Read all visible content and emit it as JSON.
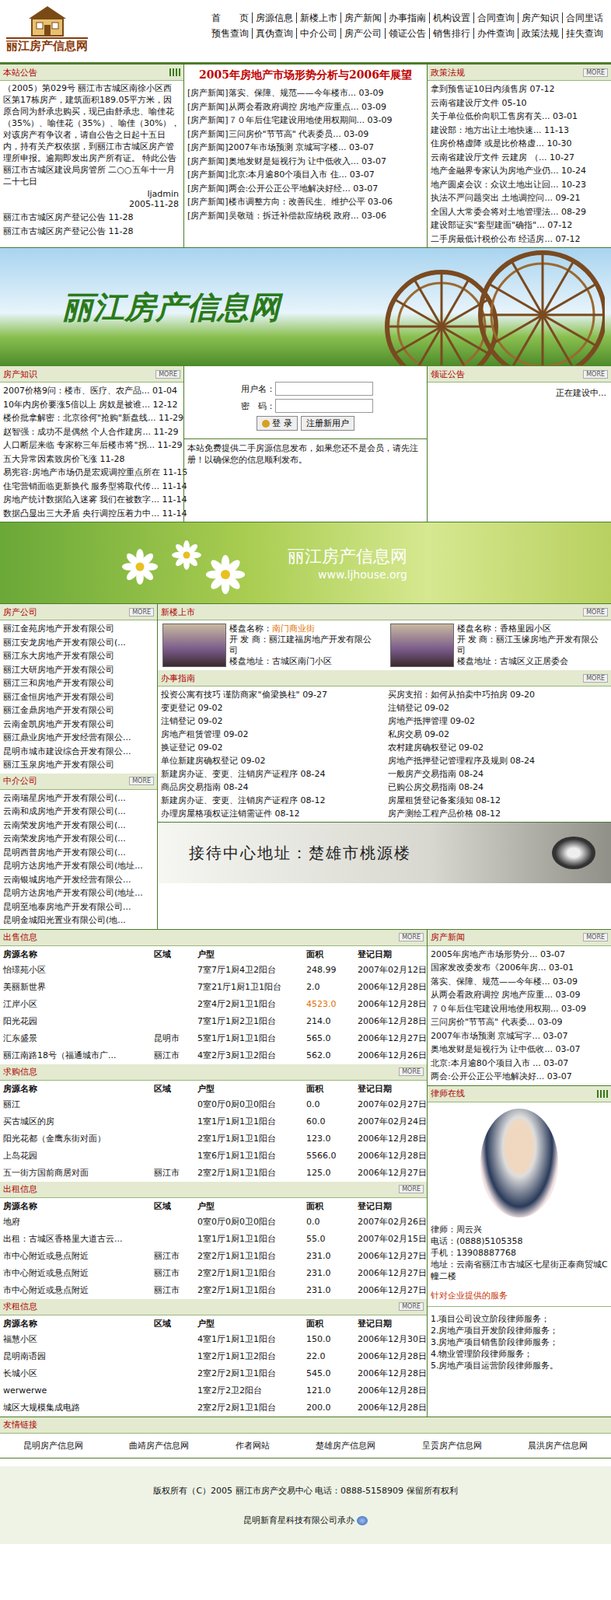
{
  "logo": {
    "title": "丽江房产信息网"
  },
  "nav": {
    "row1": [
      "首　　页",
      "房源信息",
      "新楼上市",
      "房产新闻",
      "办事指南",
      "机构设置",
      "合同查询",
      "房产知识",
      "合同里话"
    ],
    "row2": [
      "预售查询",
      "真伪查询",
      "中介公司",
      "房产公司",
      "领证公告",
      "销售排行",
      "办件查询",
      "政策法规",
      "挂失查询"
    ]
  },
  "notice": {
    "title": "本站公告",
    "body": "（2005）第029号 丽江市古城区南徐小区西区第17栋房产，建筑面积189.05平方米，因原合同为舒承忠购买，现已由舒承忠、喻佳花（35%）、喻佳花（35%）、喻佳（30%），对该房产有争议者，请自公告之日起十五日内，持有关产权依据，到丽江市古城区房产管理所申报。逾期即发出房产所有证。 特此公告 丽江市古城区建设局房管所 二○○五年十一月二十七日",
    "author": "ljadmin",
    "date": "2005-11-28",
    "items": [
      {
        "title": "丽江市古城区房产登记公告",
        "date": "11-28"
      },
      {
        "title": "丽江市古城区房产登记公告",
        "date": "11-28"
      }
    ]
  },
  "headline": {
    "title": "2005年房地产市场形势分析与2006年展望",
    "items": [
      {
        "tag": "[房产新闻]",
        "title": "落实、保障、规范——今年楼市...",
        "date": "03-09"
      },
      {
        "tag": "[房产新闻]",
        "title": "从两会看政府调控 房地产应重点...",
        "date": "03-09"
      },
      {
        "tag": "[房产新闻]",
        "title": "７０年后住宅建设用地使用权期间...",
        "date": "03-09"
      },
      {
        "tag": "[房产新闻]",
        "title": "三问房价\"节节高\" 代表委员...",
        "date": "03-09"
      },
      {
        "tag": "[房产新闻]",
        "title": "2007年市场预测 京城写字楼...",
        "date": "03-07"
      },
      {
        "tag": "[房产新闻]",
        "title": "奥地发财是短视行为 让中低收入...",
        "date": "03-07"
      },
      {
        "tag": "[房产新闻]",
        "title": "北京:本月逾80个项目入市 住...",
        "date": "03-07"
      },
      {
        "tag": "[房产新闻]",
        "title": "两会:公开公正公平地解决好经...",
        "date": "03-07"
      },
      {
        "tag": "[房产新闻]",
        "title": "楼市调整方向：改善民生、维护公平",
        "date": "03-06"
      },
      {
        "tag": "[房产新闻]",
        "title": "吴敬琏：拆迁补偿款应纳税 政府...",
        "date": "03-06"
      }
    ]
  },
  "policy": {
    "title": "政策法规",
    "more": "MORE",
    "items": [
      {
        "title": "拿到预售证10日内须售房",
        "date": "07-12"
      },
      {
        "title": "云南省建设厅文件",
        "date": "05-10"
      },
      {
        "title": "关于单位低价向职工售房有关...",
        "date": "03-01"
      },
      {
        "title": "建设部：地方出让土地快速...",
        "date": "11-13"
      },
      {
        "title": "住房价格虚降 或是比价格虚...",
        "date": "10-30"
      },
      {
        "title": "云南省建设厅文件 云建房 （...",
        "date": "10-27"
      },
      {
        "title": "地产金融界专家认为房地产业仍...",
        "date": "10-24"
      },
      {
        "title": "地产圆桌会议：众议土地出让回...",
        "date": "10-23"
      },
      {
        "title": "执法不严问题突出 土地调控问...",
        "date": "09-21"
      },
      {
        "title": "全国人大常委会将对土地管理法...",
        "date": "08-29"
      },
      {
        "title": "建设部证实\"套型建面\"确指\"...",
        "date": "07-12"
      },
      {
        "title": "二手房最低计税价公布 经适房...",
        "date": "07-12"
      }
    ]
  },
  "banner1": {
    "title": "丽江房产信息网"
  },
  "knowledge": {
    "title": "房产知识",
    "more": "MORE",
    "items": [
      {
        "title": "2007价格9问：楼市、医疗、农产品...",
        "date": "01-04"
      },
      {
        "title": "10年内房价要涨5倍以上 房奴是被谁...",
        "date": "12-12"
      },
      {
        "title": "楼价批拿解密：北京徐何\"抢购\"新盘线...",
        "date": "11-29"
      },
      {
        "title": "赵智强：成功不是偶然 个人合作建房...",
        "date": "11-29"
      },
      {
        "title": "人口断层来临 专家称三年后楼市将\"拐...",
        "date": "11-29"
      },
      {
        "title": "五大异常因素致房价飞涨",
        "date": "11-28"
      },
      {
        "title": "易宪容:房地产市场仍是宏观调控重点所在",
        "date": "11-15"
      },
      {
        "title": "住宅营销面临更新换代 服务型将取代传...",
        "date": "11-14"
      },
      {
        "title": "房地产统计数据陷入迷雾 我们在被数字...",
        "date": "11-14"
      },
      {
        "title": "数据凸显出三大矛盾 央行调控压着力中...",
        "date": "11-14"
      }
    ]
  },
  "login": {
    "user_label": "用户名：",
    "pass_label": "密　码：",
    "login_button": "登 录",
    "register_button": "注册新用户",
    "note": "本站免费提供二手房源信息发布，如果您还不是会员，请先注册！以确保您的信息顺利发布。"
  },
  "license": {
    "title": "领证公告",
    "more": "MORE",
    "body": "正在建设中..."
  },
  "banner2": {
    "title": "丽江房产信息网",
    "url": "www.ljhouse.org"
  },
  "companies": {
    "title": "房产公司",
    "more": "MORE",
    "items": [
      "丽江金苑房地产开发有限公司",
      "丽江安龙房地产开发有限公司(...",
      "丽江东大房地产开发有限公司",
      "丽江大研房地产开发有限公司",
      "丽江三和房地产开发有限公司",
      "丽江金恒房地产开发有限公司",
      "丽江金鼎房地产开发有限公司",
      "云南金凯房地产开发有限公司",
      "丽江鼎业房地产开发经营有限公...",
      "昆明市城市建设综合开发有限公...",
      "丽江玉泉房地产开发有限公司"
    ]
  },
  "agencies": {
    "title": "中介公司",
    "more": "MORE",
    "items": [
      "云南瑞星房地产开发有限公司(...",
      "云南和成房地产开发有限公司(...",
      "云南荣发房地产开发有限公司(...",
      "云南荣发房地产开发有限公司(...",
      "昆明西普房地产开发有限公司(...",
      "昆明方达房地产开发有限公司(地址...",
      "云南银城房地产开发经营有限公...",
      "昆明方达房地产开发有限公司(地址...",
      "昆明至地泰房地产开发有限公司...",
      "昆明金城阳光置业有限公司(地..."
    ]
  },
  "newbuild": {
    "title": "新楼上市",
    "more": "MORE",
    "items": [
      {
        "name_label": "楼盘名称：",
        "name": "南门商业街",
        "dev_label": "开 发 商：",
        "developer": "丽江建福房地产开发有限公司",
        "addr_label": "楼盘地址：",
        "address": "古城区南门小区",
        "highlight": true
      },
      {
        "name_label": "楼盘名称：",
        "name": "香格里园小区",
        "dev_label": "开 发 商：",
        "developer": "丽江玉缘房地产开发有限公司",
        "addr_label": "楼盘地址：",
        "address": "古城区义正居委会",
        "highlight": false
      }
    ]
  },
  "guide": {
    "title": "办事指南",
    "more": "MORE",
    "left": [
      {
        "title": "投资公寓有技巧 谨防商家\"偷梁换柱\"",
        "date": "09-27"
      },
      {
        "title": "变更登记",
        "date": "09-02"
      },
      {
        "title": "注销登记",
        "date": "09-02"
      },
      {
        "title": "房地产租赁管理",
        "date": "09-02"
      },
      {
        "title": "换证登记",
        "date": "09-02"
      },
      {
        "title": "单位新建房确权登记",
        "date": "09-02"
      },
      {
        "title": "新建房办证、变更、注销房产证程序",
        "date": "08-24"
      },
      {
        "title": "商品房交易指南",
        "date": "08-24"
      },
      {
        "title": "新建房办证、变更、注销房产证程序",
        "date": "08-12"
      },
      {
        "title": "办理房屋格项权证注销需证件",
        "date": "08-12"
      }
    ],
    "right": [
      {
        "title": "买房支招：如何从拍卖中巧拍房",
        "date": "09-20"
      },
      {
        "title": "注销登记",
        "date": "09-02"
      },
      {
        "title": "房地产抵押管理",
        "date": "09-02"
      },
      {
        "title": "私房交易",
        "date": "09-02"
      },
      {
        "title": "农村建房确权登记",
        "date": "09-02"
      },
      {
        "title": "房地产抵押登记管理程序及规则",
        "date": "08-24"
      },
      {
        "title": "一般房产交易指南",
        "date": "08-24"
      },
      {
        "title": "已购公房交易指南",
        "date": "08-24"
      },
      {
        "title": "房屋租赁登记备案须知",
        "date": "08-12"
      },
      {
        "title": "房产测绘工程产品价格",
        "date": "08-12"
      }
    ]
  },
  "banner3": {
    "title": "接待中心地址：楚雄市桃源楼"
  },
  "columns": [
    "房源名称",
    "区域",
    "户型",
    "面积",
    "登记日期"
  ],
  "listings": [
    {
      "title": "出售信息",
      "more": "MORE",
      "rows": [
        {
          "name": "怡璟苑小区",
          "region": "",
          "type": "7室7厅1厨4卫2阳台",
          "area": "248.99",
          "date": "2007年02月12日",
          "highlight": false
        },
        {
          "name": "美丽新世界",
          "region": "",
          "type": "7室21厅1厨1卫1阳台",
          "area": "2.0",
          "date": "2006年12月28日",
          "highlight": false
        },
        {
          "name": "江岸小区",
          "region": "",
          "type": "2室4厅2厨1卫1阳台",
          "area": "4523.0",
          "date": "2006年12月28日",
          "highlight": true
        },
        {
          "name": "阳光花园",
          "region": "",
          "type": "7室1厅1厨2卫1阳台",
          "area": "214.0",
          "date": "2006年12月28日",
          "highlight": false
        },
        {
          "name": "汇东盛景",
          "region": "昆明市",
          "type": "5室1厅1厨1卫1阳台",
          "area": "565.0",
          "date": "2006年12月27日",
          "highlight": false
        },
        {
          "name": "丽江南路18号（福通城市广...",
          "region": "丽江市",
          "type": "4室2厅3厨1卫2阳台",
          "area": "562.0",
          "date": "2006年12月26日",
          "highlight": false
        }
      ]
    },
    {
      "title": "求购信息",
      "more": "MORE",
      "rows": [
        {
          "name": "丽江",
          "region": "",
          "type": "0室0厅0厨0卫0阳台",
          "area": "0.0",
          "date": "2007年02月27日",
          "highlight": false
        },
        {
          "name": "买古城区的房",
          "region": "",
          "type": "1室1厅1厨1卫1阳台",
          "area": "60.0",
          "date": "2007年02月24日",
          "highlight": false
        },
        {
          "name": "阳光花都（金鹰东街对面）",
          "region": "",
          "type": "2室1厅1厨1卫1阳台",
          "area": "123.0",
          "date": "2006年12月28日",
          "highlight": false
        },
        {
          "name": "上岛花园",
          "region": "",
          "type": "1室6厅1厨1卫1阳台",
          "area": "5566.0",
          "date": "2006年12月28日",
          "highlight": false
        },
        {
          "name": "五一街方国前商居对面",
          "region": "丽江市",
          "type": "2室2厅1厨1卫1阳台",
          "area": "125.0",
          "date": "2006年12月27日",
          "highlight": false
        }
      ]
    },
    {
      "title": "出租信息",
      "more": "MORE",
      "rows": [
        {
          "name": "地府",
          "region": "",
          "type": "0室0厅0厨0卫0阳台",
          "area": "0.0",
          "date": "2007年02月26日",
          "highlight": false
        },
        {
          "name": "出租：古城区香格里大道古云...",
          "region": "",
          "type": "1室1厅1厨1卫1阳台",
          "area": "55.0",
          "date": "2007年02月15日",
          "highlight": false
        },
        {
          "name": "市中心附近或悬点附近",
          "region": "丽江市",
          "type": "2室2厅1厨1卫1阳台",
          "area": "231.0",
          "date": "2006年12月27日",
          "highlight": false
        },
        {
          "name": "市中心附近或悬点附近",
          "region": "丽江市",
          "type": "2室2厅1厨1卫1阳台",
          "area": "231.0",
          "date": "2006年12月27日",
          "highlight": false
        },
        {
          "name": "市中心附近或悬点附近",
          "region": "丽江市",
          "type": "2室2厅1厨1卫1阳台",
          "area": "231.0",
          "date": "2006年12月27日",
          "highlight": false
        }
      ]
    },
    {
      "title": "求租信息",
      "more": "MORE",
      "rows": [
        {
          "name": "福慧小区",
          "region": "",
          "type": "4室1厅1厨1卫1阳台",
          "area": "150.0",
          "date": "2006年12月30日",
          "highlight": false
        },
        {
          "name": "昆明南语园",
          "region": "",
          "type": "1室2厅1厨1卫2阳台",
          "area": "22.0",
          "date": "2006年12月28日",
          "highlight": false
        },
        {
          "name": "长城小区",
          "region": "",
          "type": "2室2厅2厨1卫1阳台",
          "area": "545.0",
          "date": "2006年12月28日",
          "highlight": false
        },
        {
          "name": "werwerwe",
          "region": "",
          "type": "1室2厅2卫2阳台",
          "area": "121.0",
          "date": "2006年12月28日",
          "highlight": false
        },
        {
          "name": "城区大规模集成电路",
          "region": "",
          "type": "2室2厅2厨1卫1阳台",
          "area": "200.0",
          "date": "2006年12月28日",
          "highlight": false
        }
      ]
    }
  ],
  "news": {
    "title": "房产新闻",
    "more": "MORE",
    "items": [
      {
        "title": "2005年房地产市场形势分...",
        "date": "03-07"
      },
      {
        "title": "国家发改委发布《2006年房...",
        "date": "03-01"
      },
      {
        "title": "落实、保障、规范——今年楼...",
        "date": "03-09"
      },
      {
        "title": "从两会看政府调控 房地产应重...",
        "date": "03-09"
      },
      {
        "title": "７０年后住宅建设用地使用权期...",
        "date": "03-09"
      },
      {
        "title": "三问房价\"节节高\" 代表委...",
        "date": "03-09"
      },
      {
        "title": "2007年市场预测 京城写字...",
        "date": "03-07"
      },
      {
        "title": "奥地发财是短视行为 让中低收...",
        "date": "03-07"
      },
      {
        "title": "北京:本月逾80个项目入市 ...",
        "date": "03-07"
      },
      {
        "title": "两会:公开公正公平地解决好...",
        "date": "03-07"
      }
    ]
  },
  "lawyer": {
    "title": "律师在线",
    "info": [
      "律师：周云兴",
      "电话：(0888)5105358",
      "手机：13908887768",
      "地址：云南省丽江市古城区七星街正泰商贸城C幢二楼"
    ],
    "services_title": "针对企业提供的服务",
    "services": [
      "1.项目公司设立阶段律师服务；",
      "2.房地产项目开发阶段律师服务；",
      "3.房地产项目销售阶段律师服务；",
      "4.物业管理阶段律师服务；",
      "5.房地产项目运营阶段律师服务。"
    ]
  },
  "links": {
    "title": "友情链接",
    "items": [
      "昆明房产信息网",
      "曲靖房产信息网",
      "作者网站",
      "楚雄房产信息网",
      "呈贡房产信息网",
      "晨洪房产信息网"
    ]
  },
  "footer": {
    "copyright": "版权所有（C）2005 丽江市房产交易中心 电话：0888-5158909 保留所有权利",
    "maker": "昆明新育星科技有限公司承办"
  }
}
